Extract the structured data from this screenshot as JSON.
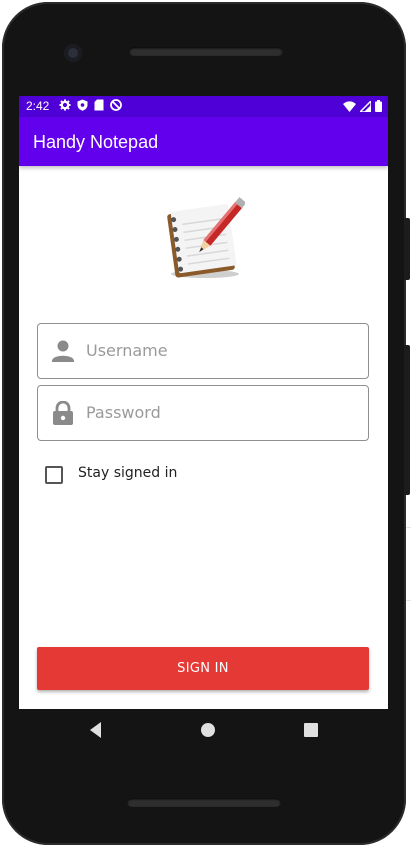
{
  "status_bar": {
    "time": "2:42",
    "icons": [
      "gear-icon",
      "shield-icon",
      "sd-card-icon",
      "no-sync-icon",
      "wifi-icon",
      "signal-icon",
      "battery-icon"
    ]
  },
  "app_bar": {
    "title": "Handy Notepad"
  },
  "logo": {
    "icon": "notepad-pencil-icon"
  },
  "form": {
    "username": {
      "placeholder": "Username",
      "value": "",
      "icon": "person-icon"
    },
    "password": {
      "placeholder": "Password",
      "value": "",
      "icon": "lock-icon"
    },
    "stay_signed_in": {
      "label": "Stay signed in",
      "checked": false
    }
  },
  "sign_in_button": {
    "label": "SIGN IN"
  },
  "nav_bar": {
    "buttons": [
      "back-icon",
      "home-icon",
      "recents-icon"
    ]
  },
  "colors": {
    "status_bar": "#4f00d6",
    "app_bar": "#6200ee",
    "sign_in_button": "#e53935",
    "field_border": "#8f8f8f",
    "placeholder": "#9a9a9a"
  }
}
